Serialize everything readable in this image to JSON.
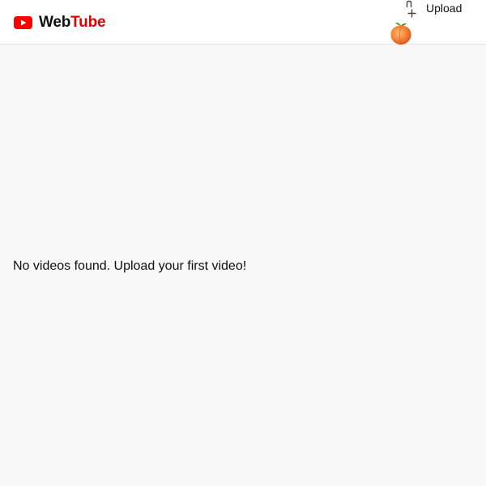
{
  "header": {
    "logo": {
      "icon": "youtube-play-icon",
      "text_part1": "Web",
      "text_part2": "Tube",
      "color_part1": "#0f0f0f",
      "color_part2": "#e00000",
      "icon_color": "#ff0000"
    },
    "upload": {
      "icon": "upload-add-icon",
      "label": "Upload"
    },
    "avatar": {
      "icon": "peach-avatar-icon"
    }
  },
  "main": {
    "empty_message": "No videos found. Upload your first video!"
  },
  "colors": {
    "background": "#f9f9f9",
    "header_background": "#ffffff",
    "header_border": "#e5e5e5",
    "text": "#0f0f0f"
  }
}
